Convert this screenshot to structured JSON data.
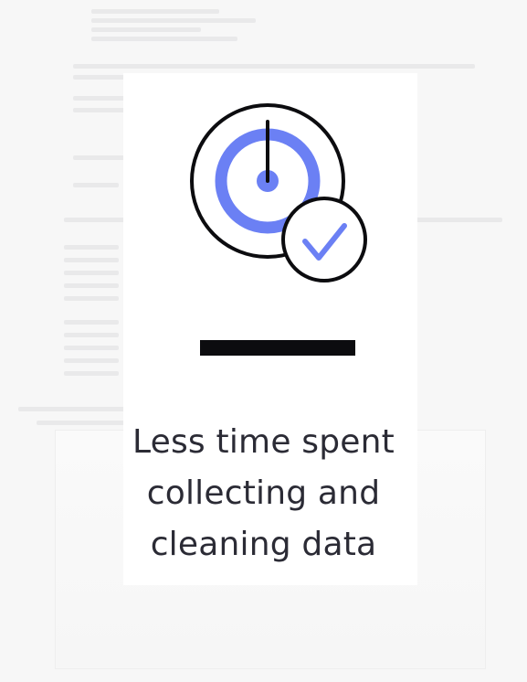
{
  "headline": {
    "line1": "Less time spent",
    "line2": "collecting and",
    "line3": "cleaning data"
  },
  "colors": {
    "accent": "#6b80f4",
    "ink": "#0c0c0f",
    "text": "#2b2b35",
    "background": "#f7f7f7",
    "card": "#ffffff"
  },
  "icons": [
    "gauge-icon",
    "checkmark-icon"
  ]
}
